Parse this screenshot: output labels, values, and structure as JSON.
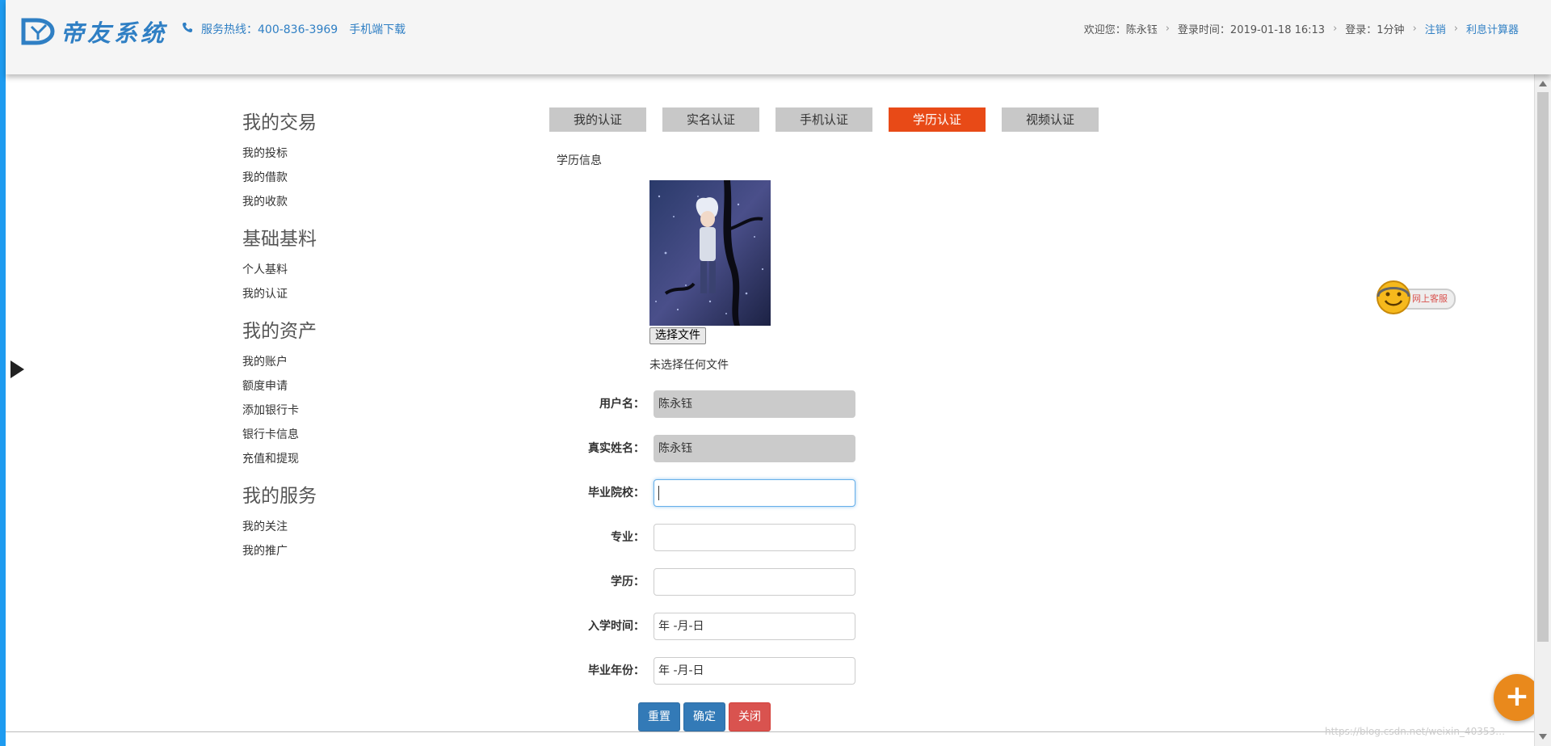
{
  "header": {
    "logo_text": "帝友系统",
    "hotline": "服务热线：400-836-3969",
    "download": "手机端下载",
    "welcome": "欢迎您：陈永钰",
    "login_time": "登录时间：2019-01-18 16:13",
    "login_duration": "登录：1分钟",
    "logout": "注销",
    "calculator": "利息计算器",
    "brand_color": "#2f7fc4"
  },
  "sidebar": {
    "groups": [
      {
        "heading": "我的交易",
        "items": [
          "我的投标",
          "我的借款",
          "我的收款"
        ]
      },
      {
        "heading": "基础基料",
        "items": [
          "个人基料",
          "我的认证"
        ]
      },
      {
        "heading": "我的资产",
        "items": [
          "我的账户",
          "额度申请",
          "添加银行卡",
          "银行卡信息",
          "充值和提现"
        ]
      },
      {
        "heading": "我的服务",
        "items": [
          "我的关注",
          "我的推广"
        ]
      }
    ]
  },
  "tabs": [
    {
      "label": "我的认证",
      "active": false
    },
    {
      "label": "实名认证",
      "active": false
    },
    {
      "label": "手机认证",
      "active": false
    },
    {
      "label": "学历认证",
      "active": true
    },
    {
      "label": "视频认证",
      "active": false
    }
  ],
  "section_label": "学历信息",
  "upload": {
    "button": "选择文件",
    "status": "未选择任何文件"
  },
  "form": {
    "username": {
      "label": "用户名：",
      "value": "陈永钰"
    },
    "realname": {
      "label": "真实姓名：",
      "value": "陈永钰"
    },
    "school": {
      "label": "毕业院校：",
      "value": ""
    },
    "major": {
      "label": "专业：",
      "value": ""
    },
    "degree": {
      "label": "学历：",
      "value": ""
    },
    "enroll": {
      "label": "入学时间：",
      "value": "年 -月-日"
    },
    "graduate": {
      "label": "毕业年份：",
      "value": "年 -月-日"
    }
  },
  "buttons": {
    "reset": "重置",
    "confirm": "确定",
    "close": "关闭"
  },
  "customer_service": "网上客服",
  "watermark": "https://blog.csdn.net/weixin_40353…",
  "colors": {
    "active_tab": "#e84a17",
    "primary_btn": "#337ab7",
    "danger_btn": "#d9534f",
    "float_btn": "#e9891c"
  }
}
